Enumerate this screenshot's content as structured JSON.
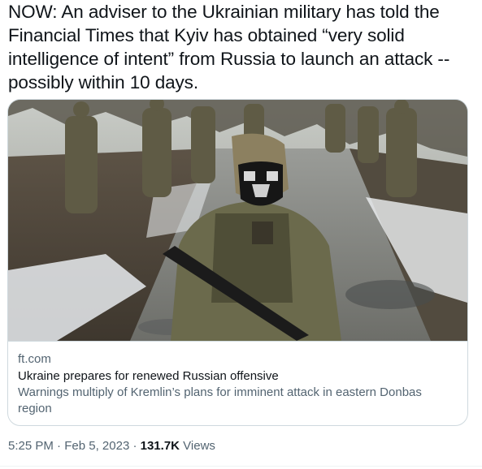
{
  "tweet": {
    "text": "NOW: An adviser to the Ukrainian military has told the Financial Times that Kyiv has obtained “very solid intelligence of intent” from Russia to launch an attack -- possibly within 10 days."
  },
  "card": {
    "domain": "ft.com",
    "title": "Ukraine prepares for renewed Russian offensive",
    "description": "Warnings multiply of Kremlin’s plans for imminent attack in eastern Donbas region"
  },
  "meta": {
    "time": "5:25 PM",
    "separator1": " · ",
    "date": "Feb 5, 2023",
    "separator2": " · ",
    "views_count": "131.7K",
    "views_label": " Views"
  }
}
